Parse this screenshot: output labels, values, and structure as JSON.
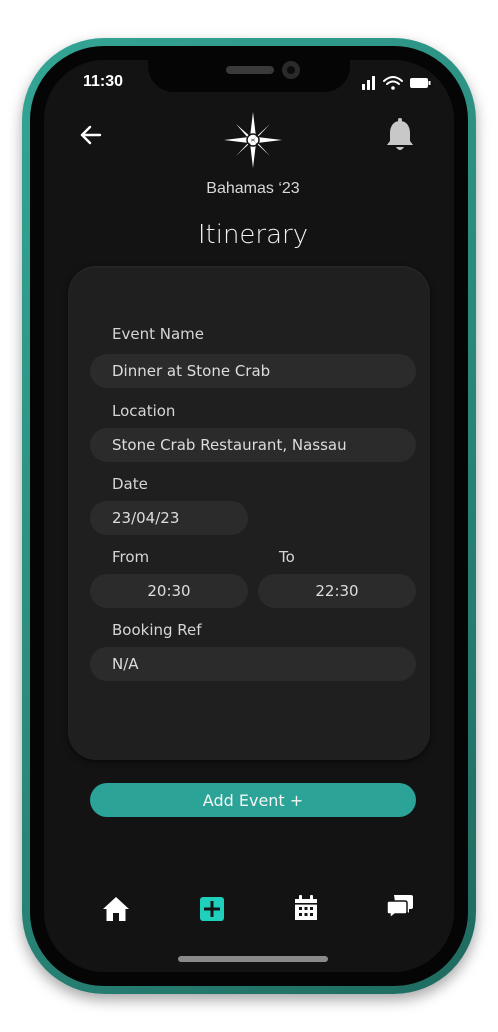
{
  "status_bar": {
    "time": "11:30",
    "icons": [
      "signal-icon",
      "wifi-icon",
      "battery-icon"
    ]
  },
  "header": {
    "back_icon": "arrow-left-icon",
    "logo_icon": "compass-star-icon",
    "bell_icon": "bell-icon",
    "trip_name": "Bahamas ‘23",
    "title": "Itinerary"
  },
  "form": {
    "event_name": {
      "label": "Event Name",
      "value": "Dinner at Stone Crab"
    },
    "location": {
      "label": "Location",
      "value": "Stone Crab Restaurant, Nassau"
    },
    "date": {
      "label": "Date",
      "value": "23/04/23"
    },
    "from": {
      "label": "From",
      "value": "20:30"
    },
    "to": {
      "label": "To",
      "value": "22:30"
    },
    "booking_ref": {
      "label": "Booking Ref",
      "value": "N/A"
    }
  },
  "actions": {
    "add_event_label": "Add Event +"
  },
  "bottom_nav": {
    "items": [
      {
        "icon": "home-icon",
        "active": false
      },
      {
        "icon": "add-square-icon",
        "active": true
      },
      {
        "icon": "calendar-icon",
        "active": false
      },
      {
        "icon": "chat-bubbles-icon",
        "active": false
      }
    ]
  },
  "colors": {
    "accent": "#2ba497",
    "frame": "#2a8b7d",
    "background": "#131313",
    "card": "#1f1f1f",
    "field": "#2b2b2b"
  }
}
